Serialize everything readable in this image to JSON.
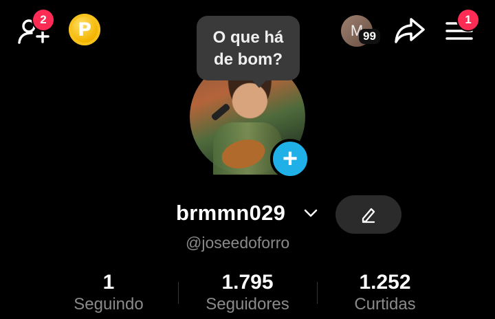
{
  "topbar": {
    "add_friends_badge": "2",
    "coin_letter": "P",
    "avatar_initial": "M",
    "avatar_count": "99",
    "menu_badge": "1"
  },
  "tooltip": {
    "line1": "O que há",
    "line2": "de bom?"
  },
  "profile": {
    "add_photo_symbol": "+",
    "username": "brmmn029",
    "handle": "@joseedoforro"
  },
  "stats": {
    "following": {
      "value": "1",
      "label": "Seguindo"
    },
    "followers": {
      "value": "1.795",
      "label": "Seguidores"
    },
    "likes": {
      "value": "1.252",
      "label": "Curtidas"
    }
  },
  "colors": {
    "background": "#000000",
    "badge": "#fe2c55",
    "add_photo": "#20b0e8",
    "coin": "#f4b400",
    "secondary_text": "#8a8a8a"
  },
  "icons": [
    "add-friend-icon",
    "coin-icon",
    "share-icon",
    "menu-icon",
    "chevron-down-icon",
    "pencil-icon",
    "plus-icon"
  ]
}
